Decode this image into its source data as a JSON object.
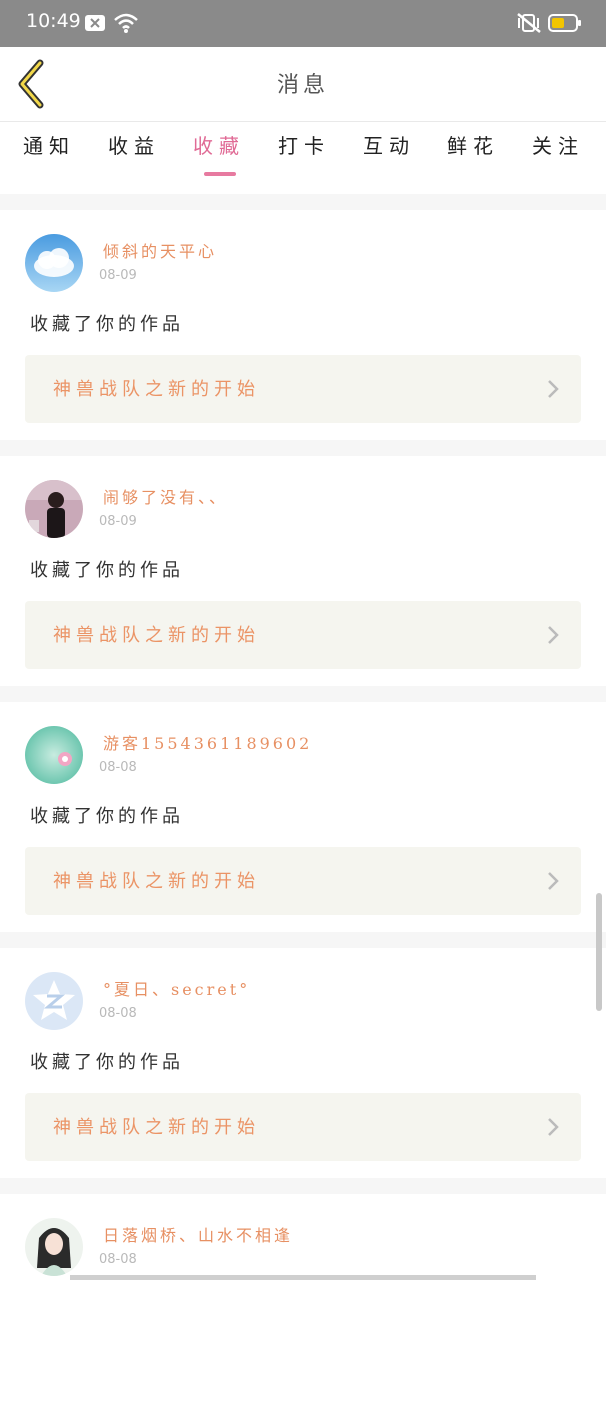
{
  "status_bar": {
    "time": "10:49"
  },
  "header": {
    "title": "消息"
  },
  "tabs": [
    {
      "label": "通知"
    },
    {
      "label": "收益"
    },
    {
      "label": "收藏",
      "active": true
    },
    {
      "label": "打卡"
    },
    {
      "label": "互动"
    },
    {
      "label": "鲜花"
    },
    {
      "label": "关注"
    }
  ],
  "items": [
    {
      "user": "倾斜的天平心",
      "date": "08-09",
      "action": "收藏了你的作品",
      "work": "神兽战队之新的开始",
      "avatar": "cloud-avatar"
    },
    {
      "user": "闹够了没有、、",
      "date": "08-09",
      "action": "收藏了你的作品",
      "work": "神兽战队之新的开始",
      "avatar": "photo-avatar"
    },
    {
      "user": "游客1554361189602",
      "date": "08-08",
      "action": "收藏了你的作品",
      "work": "神兽战队之新的开始",
      "avatar": "flower-avatar"
    },
    {
      "user": "°夏日、secret°",
      "date": "08-08",
      "action": "收藏了你的作品",
      "work": "神兽战队之新的开始",
      "avatar": "qzone-avatar"
    },
    {
      "user": "日落烟桥、山水不相逢",
      "date": "08-08",
      "action": "",
      "work": "",
      "avatar": "anime-avatar"
    }
  ],
  "colors": {
    "accent": "#e06a95",
    "username": "#e79063",
    "work_title": "#eb9466",
    "link_bg": "#f5f5ef"
  }
}
